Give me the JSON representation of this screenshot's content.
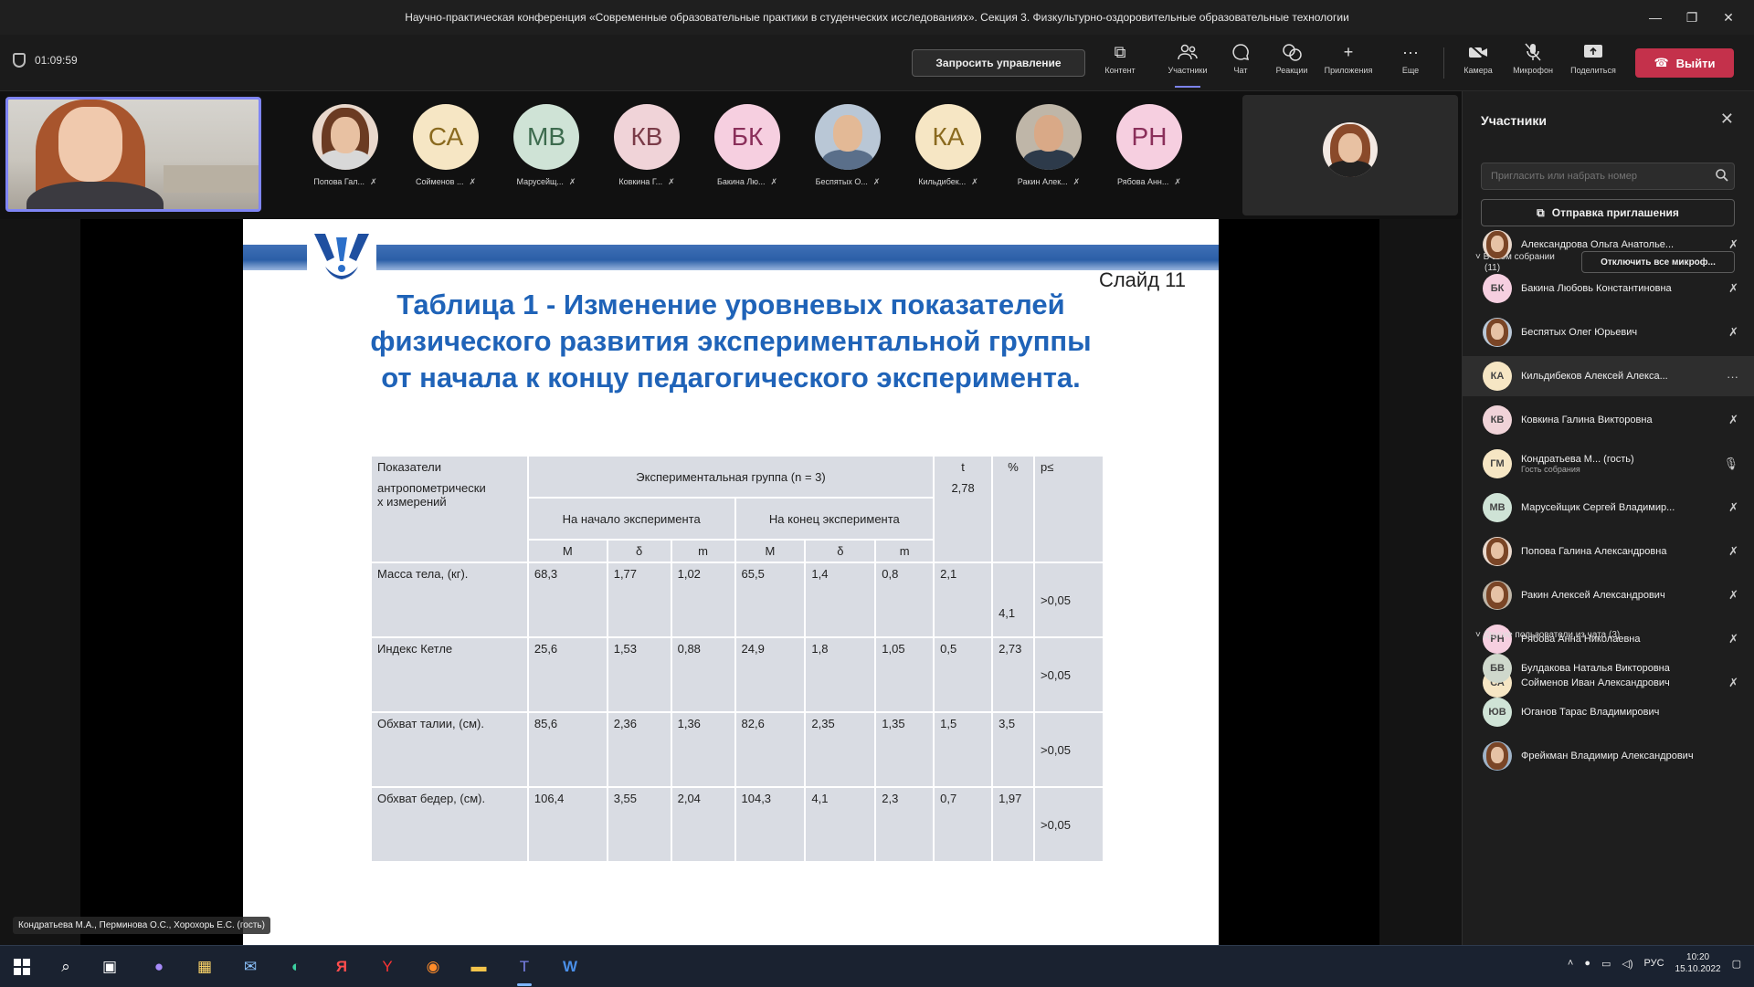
{
  "window": {
    "title": "Научно-практическая конференция «Современные образовательные практики в студенческих исследованиях». Секция 3. Физкультурно-оздоровительные образовательные технологии"
  },
  "toolbar": {
    "timer": "01:09:59",
    "request_control": "Запросить управление",
    "items": [
      {
        "label": "Контент",
        "icon": "share-content-icon"
      },
      {
        "label": "Участники",
        "icon": "people-icon"
      },
      {
        "label": "Чат",
        "icon": "chat-icon"
      },
      {
        "label": "Реакции",
        "icon": "reactions-icon"
      },
      {
        "label": "Приложения",
        "icon": "plus-icon"
      },
      {
        "label": "Еще",
        "icon": "more-icon"
      },
      {
        "label": "Камера",
        "icon": "camera-off-icon"
      },
      {
        "label": "Микрофон",
        "icon": "mic-off-icon"
      },
      {
        "label": "Поделиться",
        "icon": "share-tray-icon"
      }
    ],
    "leave": "Выйти"
  },
  "strip": {
    "participants": [
      {
        "initials": "",
        "name": "Попова Гал...",
        "color": "#e9d8cc"
      },
      {
        "initials": "СА",
        "name": "Сойменов ...",
        "color": "#f6e6c4"
      },
      {
        "initials": "МВ",
        "name": "Марусейщ...",
        "color": "#cfe3d6"
      },
      {
        "initials": "КВ",
        "name": "Ковкина Г...",
        "color": "#f0d3d8"
      },
      {
        "initials": "БК",
        "name": "Бакина Лю...",
        "color": "#f6cfe0"
      },
      {
        "initials": "",
        "name": "Беспятых О...",
        "color": "#b9c7d6"
      },
      {
        "initials": "КА",
        "name": "Кильдибек...",
        "color": "#f6e6c4"
      },
      {
        "initials": "",
        "name": "Ракин Алек...",
        "color": "#bfb6a8"
      },
      {
        "initials": "РН",
        "name": "Рябова Анн...",
        "color": "#f6cfe0"
      }
    ]
  },
  "slide": {
    "number": "Слайд 11",
    "title_lines": [
      "Таблица 1 - Изменение уровневых показателей",
      "физического развития экспериментальной группы",
      "от начала к концу педагогического эксперимента."
    ],
    "table": {
      "col1_header": [
        "Показатели",
        "антропометрически",
        "х измерений"
      ],
      "group_header": "Экспериментальная группа (n = 3)",
      "t_header": "t",
      "t_crit": "2,78",
      "pct_header": "%",
      "p_header": "p≤",
      "start_header": "На начало эксперимента",
      "end_header": "На конец эксперимента",
      "sub": [
        "M",
        "δ",
        "m",
        "M",
        "δ",
        "m"
      ],
      "rows": [
        {
          "name": "Масса тела, (кг).",
          "v": [
            "68,3",
            "1,77",
            "1,02",
            "65,5",
            "1,4",
            "0,8"
          ],
          "t": "2,1",
          "pct": "4,1",
          "p": ">0,05"
        },
        {
          "name": "Индекс Кетле",
          "v": [
            "25,6",
            "1,53",
            "0,88",
            "24,9",
            "1,8",
            "1,05"
          ],
          "t": "0,5",
          "pct": "2,73",
          "p": ">0,05"
        },
        {
          "name": "Обхват талии, (см).",
          "v": [
            "85,6",
            "2,36",
            "1,36",
            "82,6",
            "2,35",
            "1,35"
          ],
          "t": "1,5",
          "pct": "3,5",
          "p": ">0,05"
        },
        {
          "name": "Обхват бедер, (см).",
          "v": [
            "106,4",
            "3,55",
            "2,04",
            "104,3",
            "4,1",
            "2,3"
          ],
          "t": "0,7",
          "pct": "1,97",
          "p": ">0,05"
        }
      ]
    }
  },
  "presenter_overlay": "Кондратьева М.А., Перминова О.С., Хорохорь Е.С. (гость)",
  "panel": {
    "title": "Участники",
    "invite_placeholder": "Пригласить или набрать номер",
    "send_invite": "Отправка приглашения",
    "in_meeting_label": [
      "В этом собрании",
      "(11)"
    ],
    "mute_all": "Отключить все микроф...",
    "others_label": "Другие пользователи из чата (3)",
    "in_meeting": [
      {
        "initials": "",
        "name": "Александрова Ольга Анатолье...",
        "sub": "",
        "color": "#e9d8cc",
        "icon": "mic-off-icon"
      },
      {
        "initials": "БК",
        "name": "Бакина Любовь Константиновна",
        "sub": "",
        "color": "#f6cfe0",
        "icon": "mic-off-icon"
      },
      {
        "initials": "",
        "name": "Беспятых Олег Юрьевич",
        "sub": "",
        "color": "#b9c7d6",
        "icon": "mic-off-icon"
      },
      {
        "initials": "КА",
        "name": "Кильдибеков Алексей Алекса...",
        "sub": "",
        "color": "#f6e6c4",
        "icon": "more-icon"
      },
      {
        "initials": "КВ",
        "name": "Ковкина Галина Викторовна",
        "sub": "",
        "color": "#f0d3d8",
        "icon": "mic-off-icon"
      },
      {
        "initials": "ГМ",
        "name": "Кондратьева М... (гость)",
        "sub": "Гость собрания",
        "color": "#f6e6c4",
        "icon": "mic-on-icon"
      },
      {
        "initials": "МВ",
        "name": "Марусейщик Сергей Владимир...",
        "sub": "",
        "color": "#cfe3d6",
        "icon": "mic-off-icon"
      },
      {
        "initials": "",
        "name": "Попова Галина Александровна",
        "sub": "",
        "color": "#e9d8cc",
        "icon": "mic-off-icon"
      },
      {
        "initials": "",
        "name": "Ракин Алексей Александрович",
        "sub": "",
        "color": "#bfb6a8",
        "icon": "mic-off-icon"
      },
      {
        "initials": "РН",
        "name": "Рябова Анна Николаевна",
        "sub": "",
        "color": "#f6cfe0",
        "icon": "mic-off-icon"
      },
      {
        "initials": "СА",
        "name": "Сойменов Иван Александрович",
        "sub": "",
        "color": "#f6e6c4",
        "icon": "mic-off-icon"
      }
    ],
    "others": [
      {
        "initials": "БВ",
        "name": "Булдакова Наталья Викторовна",
        "color": "#cfd8cc"
      },
      {
        "initials": "ЮВ",
        "name": "Юганов Тарас Владимирович",
        "color": "#cfe3d6"
      },
      {
        "initials": "",
        "name": "Фрейкман Владимир Александрович",
        "color": "#9fb3c8"
      }
    ]
  },
  "taskbar": {
    "lang": "РУС",
    "time": "10:20",
    "date": "15.10.2022"
  }
}
